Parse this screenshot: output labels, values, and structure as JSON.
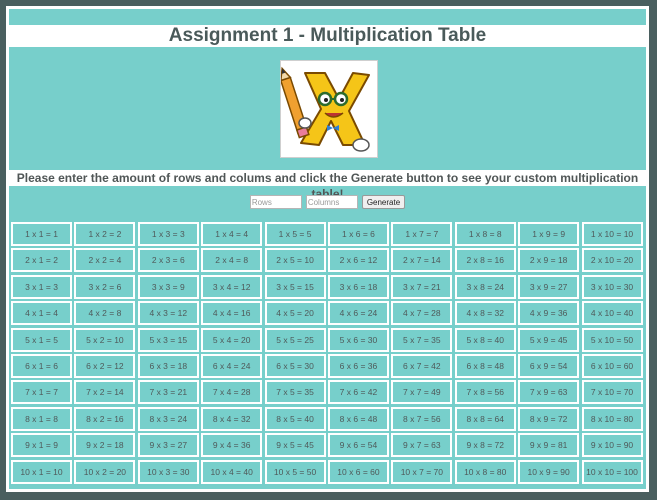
{
  "page": {
    "title": "Assignment 1 - Multiplication Table",
    "instructions": "Please enter the amount of rows and colums and click the Generate button to see your custom multiplication table!",
    "logo": "cartoon-x-with-pencil-logo"
  },
  "form": {
    "rows_placeholder": "Rows",
    "rows_value": "",
    "columns_placeholder": "Columns",
    "columns_value": "",
    "generate_label": "Generate"
  },
  "table": {
    "rows": 10,
    "columns": 10,
    "cells": [
      [
        "1 x 1 = 1",
        "1 x 2 = 2",
        "1 x 3 = 3",
        "1 x 4 = 4",
        "1 x 5 = 5",
        "1 x 6 = 6",
        "1 x 7 = 7",
        "1 x 8 = 8",
        "1 x 9 = 9",
        "1 x 10 = 10"
      ],
      [
        "2 x 1 = 2",
        "2 x 2 = 4",
        "2 x 3 = 6",
        "2 x 4 = 8",
        "2 x 5 = 10",
        "2 x 6 = 12",
        "2 x 7 = 14",
        "2 x 8 = 16",
        "2 x 9 = 18",
        "2 x 10 = 20"
      ],
      [
        "3 x 1 = 3",
        "3 x 2 = 6",
        "3 x 3 = 9",
        "3 x 4 = 12",
        "3 x 5 = 15",
        "3 x 6 = 18",
        "3 x 7 = 21",
        "3 x 8 = 24",
        "3 x 9 = 27",
        "3 x 10 = 30"
      ],
      [
        "4 x 1 = 4",
        "4 x 2 = 8",
        "4 x 3 = 12",
        "4 x 4 = 16",
        "4 x 5 = 20",
        "4 x 6 = 24",
        "4 x 7 = 28",
        "4 x 8 = 32",
        "4 x 9 = 36",
        "4 x 10 = 40"
      ],
      [
        "5 x 1 = 5",
        "5 x 2 = 10",
        "5 x 3 = 15",
        "5 x 4 = 20",
        "5 x 5 = 25",
        "5 x 6 = 30",
        "5 x 7 = 35",
        "5 x 8 = 40",
        "5 x 9 = 45",
        "5 x 10 = 50"
      ],
      [
        "6 x 1 = 6",
        "6 x 2 = 12",
        "6 x 3 = 18",
        "6 x 4 = 24",
        "6 x 5 = 30",
        "6 x 6 = 36",
        "6 x 7 = 42",
        "6 x 8 = 48",
        "6 x 9 = 54",
        "6 x 10 = 60"
      ],
      [
        "7 x 1 = 7",
        "7 x 2 = 14",
        "7 x 3 = 21",
        "7 x 4 = 28",
        "7 x 5 = 35",
        "7 x 6 = 42",
        "7 x 7 = 49",
        "7 x 8 = 56",
        "7 x 9 = 63",
        "7 x 10 = 70"
      ],
      [
        "8 x 1 = 8",
        "8 x 2 = 16",
        "8 x 3 = 24",
        "8 x 4 = 32",
        "8 x 5 = 40",
        "8 x 6 = 48",
        "8 x 7 = 56",
        "8 x 8 = 64",
        "8 x 9 = 72",
        "8 x 10 = 80"
      ],
      [
        "9 x 1 = 9",
        "9 x 2 = 18",
        "9 x 3 = 27",
        "9 x 4 = 36",
        "9 x 5 = 45",
        "9 x 6 = 54",
        "9 x 7 = 63",
        "9 x 8 = 72",
        "9 x 9 = 81",
        "9 x 10 = 90"
      ],
      [
        "10 x 1 = 10",
        "10 x 2 = 20",
        "10 x 3 = 30",
        "10 x 4 = 40",
        "10 x 5 = 50",
        "10 x 6 = 60",
        "10 x 7 = 70",
        "10 x 8 = 80",
        "10 x 9 = 90",
        "10 x 10 = 100"
      ]
    ]
  },
  "colors": {
    "page_background": "#4a5f5f",
    "panel_background": "#77cfcb",
    "cell_border": "#ffffff",
    "text": "#4f5a5a"
  }
}
